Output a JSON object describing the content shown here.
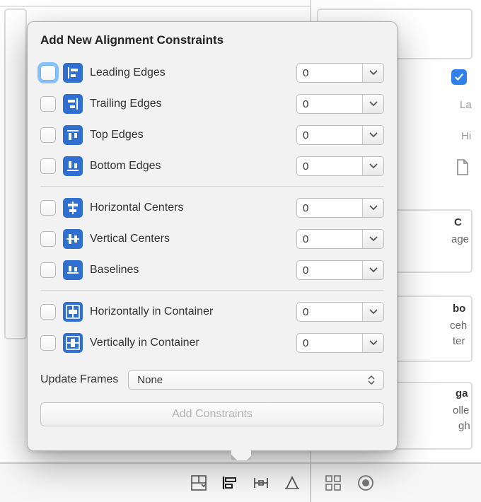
{
  "title": "Add New Alignment Constraints",
  "groups": [
    {
      "rows": [
        {
          "id": "leading",
          "label": "Leading Edges",
          "value": "0",
          "focused": true
        },
        {
          "id": "trailing",
          "label": "Trailing Edges",
          "value": "0",
          "focused": false
        },
        {
          "id": "top",
          "label": "Top Edges",
          "value": "0",
          "focused": false
        },
        {
          "id": "bottom",
          "label": "Bottom Edges",
          "value": "0",
          "focused": false
        }
      ]
    },
    {
      "rows": [
        {
          "id": "hcenters",
          "label": "Horizontal Centers",
          "value": "0",
          "focused": false
        },
        {
          "id": "vcenters",
          "label": "Vertical Centers",
          "value": "0",
          "focused": false
        },
        {
          "id": "baselines",
          "label": "Baselines",
          "value": "0",
          "focused": false
        }
      ]
    },
    {
      "rows": [
        {
          "id": "hcontainer",
          "label": "Horizontally in Container",
          "value": "0",
          "focused": false
        },
        {
          "id": "vcontainer",
          "label": "Vertically in Container",
          "value": "0",
          "focused": false
        }
      ]
    }
  ],
  "updateFrames": {
    "label": "Update Frames",
    "value": "None"
  },
  "addButton": "Add Constraints",
  "behind": {
    "la": "La",
    "hi": "Hi",
    "cLine": "C",
    "age": "age",
    "bo": "bo",
    "ceh": "ceh",
    "ter": "ter",
    "ga": "ga",
    "olle": "olle",
    "gh": "gh"
  }
}
